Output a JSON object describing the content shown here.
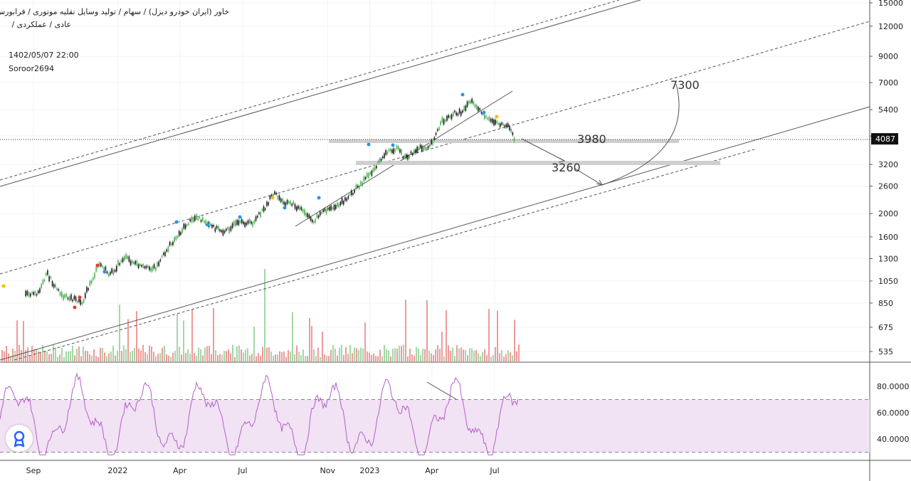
{
  "header": {
    "title": "خاور (ایران خودرو دیزل) / سهام / تولید وسایل نقلیه موتوری / فرابورس",
    "subtitle": "عادی / عملکردی /",
    "date": "1402/05/07 22:00",
    "author": "Soroor2694"
  },
  "colors": {
    "up": "#4caf50",
    "down": "#1a1a1a",
    "rsi_line": "#b45fc8",
    "rsi_band": "#f1e2f4",
    "vol_up": "#a5d6a7",
    "vol_down": "#ef9a9a",
    "annotation": "#555555"
  },
  "chart_data": [
    {
      "type": "line",
      "name": "price",
      "y_scale": "log",
      "y_ticks": [
        15000,
        12000,
        9000,
        7000,
        5400,
        4200,
        3200,
        2600,
        2000,
        1600,
        1300,
        1050,
        850,
        675,
        535
      ],
      "y_tick_labels": [
        "15000",
        "12000",
        "9000",
        "7000",
        "5400",
        "",
        "3200",
        "2600",
        "2000",
        "1600",
        "1300",
        "1050",
        "850",
        "675",
        "535"
      ],
      "last_price": "4087",
      "x_tick_labels": [
        "Sep",
        "2022",
        "Apr",
        "Jul",
        "Nov",
        "2023",
        "Apr",
        "Jul"
      ],
      "price_path": [
        [
          "2021-08-20",
          950
        ],
        [
          "2021-09-01",
          920
        ],
        [
          "2021-09-10",
          960
        ],
        [
          "2021-09-20",
          1130
        ],
        [
          "2021-10-01",
          1000
        ],
        [
          "2021-10-15",
          900
        ],
        [
          "2021-11-01",
          880
        ],
        [
          "2021-11-10",
          860
        ],
        [
          "2021-11-20",
          1000
        ],
        [
          "2021-12-05",
          1240
        ],
        [
          "2021-12-20",
          1110
        ],
        [
          "2022-01-10",
          1320
        ],
        [
          "2022-01-25",
          1240
        ],
        [
          "2022-02-10",
          1180
        ],
        [
          "2022-02-25",
          1200
        ],
        [
          "2022-03-15",
          1450
        ],
        [
          "2022-03-25",
          1580
        ],
        [
          "2022-04-10",
          1800
        ],
        [
          "2022-04-25",
          1950
        ],
        [
          "2022-05-10",
          1800
        ],
        [
          "2022-05-25",
          1730
        ],
        [
          "2022-06-05",
          1680
        ],
        [
          "2022-06-15",
          1780
        ],
        [
          "2022-07-01",
          1830
        ],
        [
          "2022-07-15",
          1830
        ],
        [
          "2022-08-01",
          2100
        ],
        [
          "2022-08-15",
          2450
        ],
        [
          "2022-08-25",
          2250
        ],
        [
          "2022-09-10",
          2200
        ],
        [
          "2022-09-25",
          2050
        ],
        [
          "2022-10-10",
          1850
        ],
        [
          "2022-10-20",
          2000
        ],
        [
          "2022-11-01",
          2100
        ],
        [
          "2022-11-15",
          2150
        ],
        [
          "2022-11-28",
          2300
        ],
        [
          "2022-12-15",
          2600
        ],
        [
          "2022-12-28",
          2850
        ],
        [
          "2023-01-10",
          3150
        ],
        [
          "2023-01-20",
          3500
        ],
        [
          "2023-02-01",
          3700
        ],
        [
          "2023-02-10",
          3700
        ],
        [
          "2023-02-20",
          3400
        ],
        [
          "2023-03-05",
          3600
        ],
        [
          "2023-03-15",
          3750
        ],
        [
          "2023-03-25",
          3800
        ],
        [
          "2023-04-01",
          4000
        ],
        [
          "2023-04-05",
          4200
        ],
        [
          "2023-04-15",
          4800
        ],
        [
          "2023-05-01",
          5200
        ],
        [
          "2023-05-15",
          5300
        ],
        [
          "2023-05-25",
          5900
        ],
        [
          "2023-06-05",
          5600
        ],
        [
          "2023-06-20",
          4900
        ],
        [
          "2023-07-01",
          4800
        ],
        [
          "2023-07-10",
          4700
        ],
        [
          "2023-07-20",
          4600
        ],
        [
          "2023-07-25",
          4300
        ],
        [
          "2023-07-29",
          4087
        ]
      ],
      "annotations": [
        "7300",
        "3980",
        "3260"
      ]
    },
    {
      "type": "line",
      "name": "oscillator",
      "y_ticks": [
        80,
        60,
        40
      ],
      "y_tick_labels": [
        "80.0000",
        "60.0000",
        "40.0000"
      ],
      "band": [
        30,
        70
      ]
    }
  ]
}
